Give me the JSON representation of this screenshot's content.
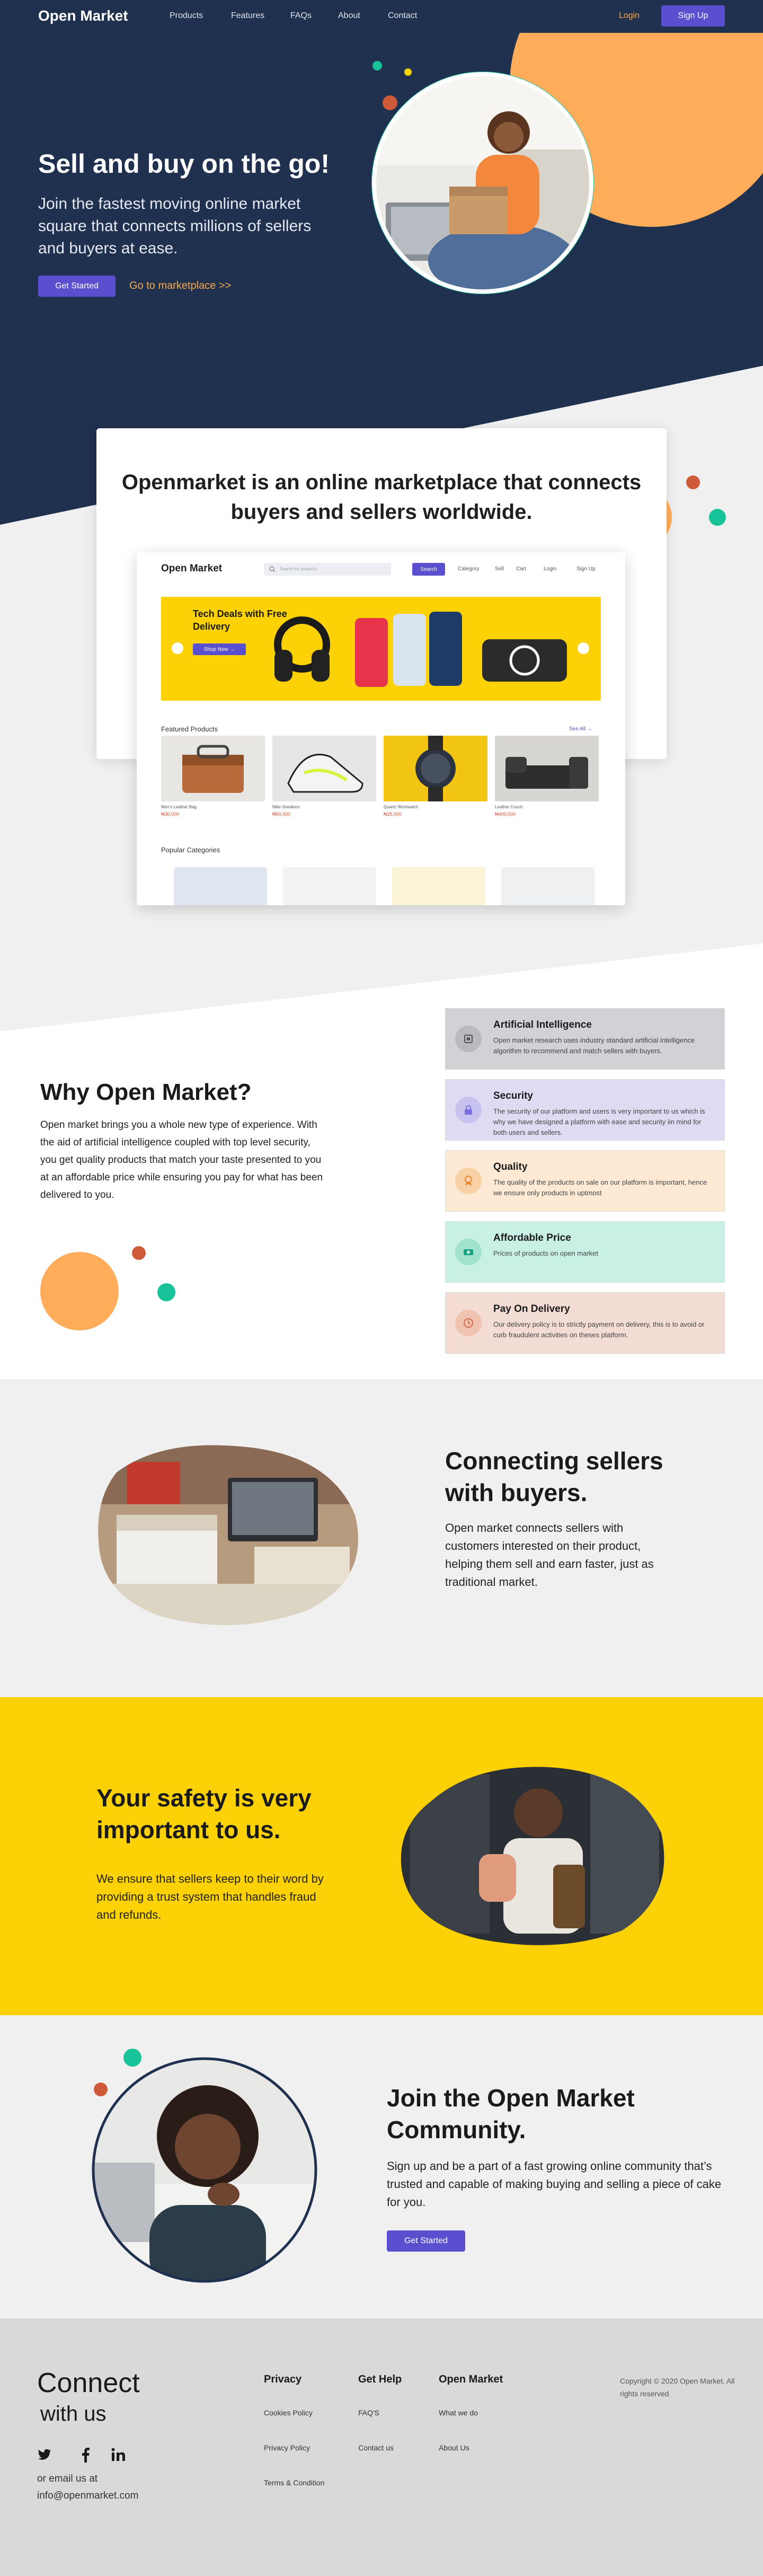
{
  "nav": {
    "logo": "Open Market",
    "links": [
      "Products",
      "Features",
      "FAQs",
      "About",
      "Contact"
    ],
    "login": "Login",
    "signup": "Sign Up"
  },
  "hero": {
    "title": "Sell and buy on the go!",
    "subtitle": "Join the fastest moving online market square that connects millions of sellers and buyers at ease.",
    "cta": "Get Started",
    "link": "Go to marketplace >>"
  },
  "intro": {
    "title": "Openmarket is an online marketplace that connects buyers and sellers worldwide."
  },
  "mockup": {
    "logo": "Open Market",
    "search_placeholder": "Search for products",
    "search_button": "Search",
    "nav": [
      "Category",
      "Sell",
      "Cart",
      "Login",
      "Sign Up"
    ],
    "banner_title": "Tech Deals with Free Delivery",
    "banner_button": "Shop Now →",
    "featured_title": "Featured Products",
    "see_all": "See All →",
    "products": [
      {
        "name": "Men's Leather Bag",
        "price": "₦30,000"
      },
      {
        "name": "Nike Sneakers",
        "price": "₦50,000"
      },
      {
        "name": "Quartz Wristwatch",
        "price": "₦25,000"
      },
      {
        "name": "Leather Couch",
        "price": "₦400,000"
      }
    ],
    "categories_title": "Popular Categories"
  },
  "why": {
    "title": "Why Open Market?",
    "body": "Open market brings you a whole new type of experience. With the aid of artificial intelligence coupled with top level security, you get quality products that match your taste presented to you at an affordable price while ensuring you pay for what has been delivered to you.",
    "features": [
      {
        "title": "Artificial Intelligence",
        "desc": "Open market research uses industry standard artificial intelligence algorithm to recommend and match sellers with buyers.",
        "bg": "#d1d1d6",
        "icon": "chip-icon",
        "icon_bg": "#b9b9c0"
      },
      {
        "title": "Security",
        "desc": "The security of our platform and users is very important to us which is why we have designed a platform with ease and security iin mind for both users and sellers.",
        "bg": "#dedbf3",
        "icon": "lock-icon",
        "icon_bg": "#c8c2ef"
      },
      {
        "title": "Quality",
        "desc": "The quality of the products on sale on our platform is important, hence we ensure only products in uptmost",
        "bg": "#fde9d4",
        "icon": "quality-icon",
        "icon_bg": "#f9d1a7"
      },
      {
        "title": "Affordable Price",
        "desc": "Prices of products on open market",
        "bg": "#c9f0e4",
        "icon": "money-icon",
        "icon_bg": "#9fe2cd"
      },
      {
        "title": "Pay On Delivery",
        "desc": "Our delivery policy is to strictly payment on delivery, this is to avoid or curb fraudulent activities on theses platform.",
        "bg": "#f3dcd4",
        "icon": "delivery-icon",
        "icon_bg": "#f0c2b0"
      }
    ]
  },
  "connecting": {
    "title": "Connecting sellers with buyers.",
    "body": "Open market connects sellers with customers interested on their product, helping them sell and earn faster, just as traditional market."
  },
  "safety": {
    "title": "Your safety is very important to us.",
    "body": "We ensure that sellers keep to their word by providing a trust system that handles fraud and refunds."
  },
  "join": {
    "title": "Join the Open Market Community.",
    "body": "Sign up and be a part of a fast growing online community that’s trusted and capable of making buying and selling a piece of cake for you.",
    "cta": "Get Started"
  },
  "footer": {
    "connect": "Connect",
    "with_us": "with us",
    "email_label": "or email us at",
    "email": "info@openmarket.com",
    "privacy": {
      "title": "Privacy",
      "links": [
        "Cookies Policy",
        "Privacy Policy",
        "Terms & Condition"
      ]
    },
    "help": {
      "title": "Get Help",
      "links": [
        "FAQ'S",
        "Contact us"
      ]
    },
    "openmarket": {
      "title": "Open Market",
      "links": [
        "What we do",
        "About Us"
      ]
    },
    "copyright": "Copyright © 2020 Open Market. All rights reserved"
  },
  "colors": {
    "navy": "#20304f",
    "orange": "#ffad5b",
    "purple": "#5a4fcf",
    "yellow": "#fcd105",
    "green": "#19c39a",
    "rust": "#cf5a3a"
  }
}
